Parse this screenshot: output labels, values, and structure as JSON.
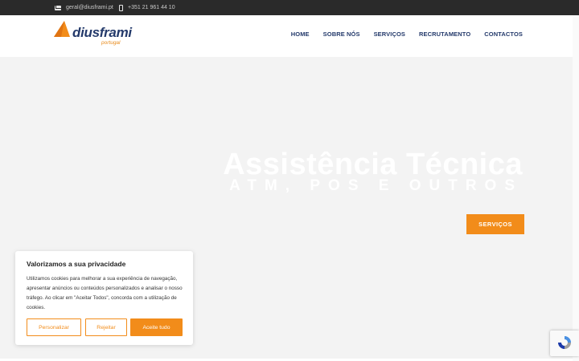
{
  "topbar": {
    "email": "geral@diusframi.pt",
    "phone": "+351 21 961 44 10"
  },
  "logo": {
    "name": "diusframi",
    "subtitle": "portugal"
  },
  "nav": {
    "items": [
      "HOME",
      "SOBRE NÓS",
      "SERVIÇOS",
      "RECRUTAMENTO",
      "CONTACTOS"
    ]
  },
  "hero": {
    "title": "Assistência Técnica",
    "subtitle": "ATM, POS E OUTROS",
    "button_label": "SERVIÇOS"
  },
  "cookie": {
    "title": "Valorizamos a sua privacidade",
    "text": "Utilizamos cookies para melhorar a sua experiência de navegação, apresentar anúncios ou conteúdos personalizados e analisar o nosso tráfego. Ao clicar em \"Aceitar Todos\", concorda com a utilização de cookies.",
    "customize_label": "Personalizar",
    "reject_label": "Rejeitar",
    "accept_label": "Aceite tudo"
  },
  "colors": {
    "accent": "#f28c1a",
    "brand_navy": "#243a6b",
    "topbar": "#2a2a2a"
  },
  "icons": {
    "email": "envelope-icon",
    "phone": "mobile-phone-icon",
    "logo_mark": "triangle-logo-mark",
    "recaptcha": "recaptcha-icon"
  }
}
